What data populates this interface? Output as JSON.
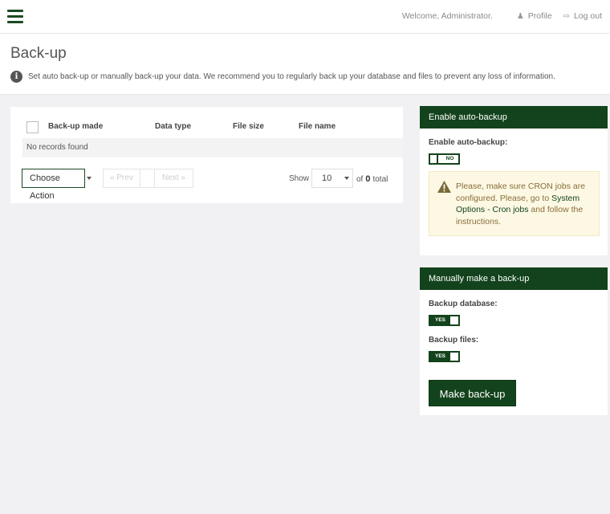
{
  "topbar": {
    "welcome": "Welcome, Administrator.",
    "profile_label": "Profile",
    "logout_label": "Log out"
  },
  "header": {
    "title": "Back-up",
    "description": "Set auto back-up or manually back-up your data. We recommend you to regularly back up your database and files to prevent any loss of information."
  },
  "table": {
    "columns": [
      "Back-up made",
      "Data type",
      "File size",
      "File name"
    ],
    "empty_message": "No records found",
    "choose_action_label": "Choose Action",
    "prev_label": "« Prev",
    "next_label": "Next »",
    "show_label": "Show",
    "page_size": "10",
    "of_label": "of",
    "total_count": "0",
    "total_label": "total"
  },
  "auto_backup": {
    "panel_title": "Enable auto-backup",
    "field_label": "Enable auto-backup:",
    "toggle_text": "NO",
    "warning_text_1": "Please, make sure CRON jobs are configured. Please, go to ",
    "warning_link": "System Options - Cron jobs",
    "warning_text_2": " and follow the instructions."
  },
  "manual_backup": {
    "panel_title": "Manually make a back-up",
    "database_label": "Backup database:",
    "database_toggle": "YES",
    "files_label": "Backup files:",
    "files_toggle": "YES",
    "make_button": "Make back-up"
  },
  "colors": {
    "brand_green": "#13431c",
    "warning_bg": "#fcf8e3",
    "warning_text": "#8a6d3b"
  }
}
